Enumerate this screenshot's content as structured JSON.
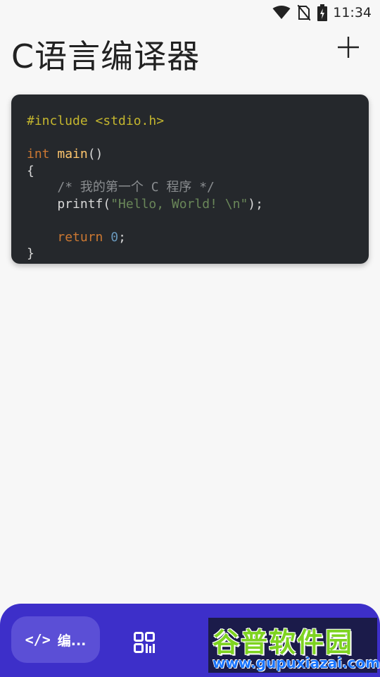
{
  "status_bar": {
    "time": "11:34",
    "icons": [
      "wifi-icon",
      "no-sim-icon",
      "battery-charging-icon"
    ]
  },
  "header": {
    "title": "C语言编译器",
    "add_icon": "plus-icon"
  },
  "code_editor": {
    "lines": [
      {
        "segments": [
          {
            "cls": "pre",
            "text": "#include <stdio.h>"
          }
        ]
      },
      {
        "segments": []
      },
      {
        "segments": [
          {
            "cls": "kw",
            "text": "int"
          },
          {
            "cls": "",
            "text": " "
          },
          {
            "cls": "fn",
            "text": "main"
          },
          {
            "cls": "",
            "text": "()"
          }
        ]
      },
      {
        "segments": [
          {
            "cls": "",
            "text": "{"
          }
        ]
      },
      {
        "segments": [
          {
            "cls": "",
            "text": "    "
          },
          {
            "cls": "cm",
            "text": "/* 我的第一个 C 程序 */"
          }
        ]
      },
      {
        "segments": [
          {
            "cls": "",
            "text": "    printf("
          },
          {
            "cls": "str",
            "text": "\"Hello, World! \\n\""
          },
          {
            "cls": "",
            "text": ");"
          }
        ]
      },
      {
        "segments": []
      },
      {
        "segments": [
          {
            "cls": "",
            "text": "    "
          },
          {
            "cls": "kw",
            "text": "return"
          },
          {
            "cls": "",
            "text": " "
          },
          {
            "cls": "num",
            "text": "0"
          },
          {
            "cls": "",
            "text": ";"
          }
        ]
      },
      {
        "segments": [
          {
            "cls": "",
            "text": "}"
          }
        ]
      }
    ]
  },
  "bottom_nav": {
    "editor_label": "编...",
    "editor_icon": "code-icon",
    "qr_icon": "qr-code-icon"
  },
  "watermark": {
    "logo": "谷普软件园",
    "url": "www.gupuxiazai.com"
  },
  "colors": {
    "nav_bg": "#3d2fc9",
    "nav_active": "#5b4fd6",
    "code_bg": "#25282c"
  }
}
